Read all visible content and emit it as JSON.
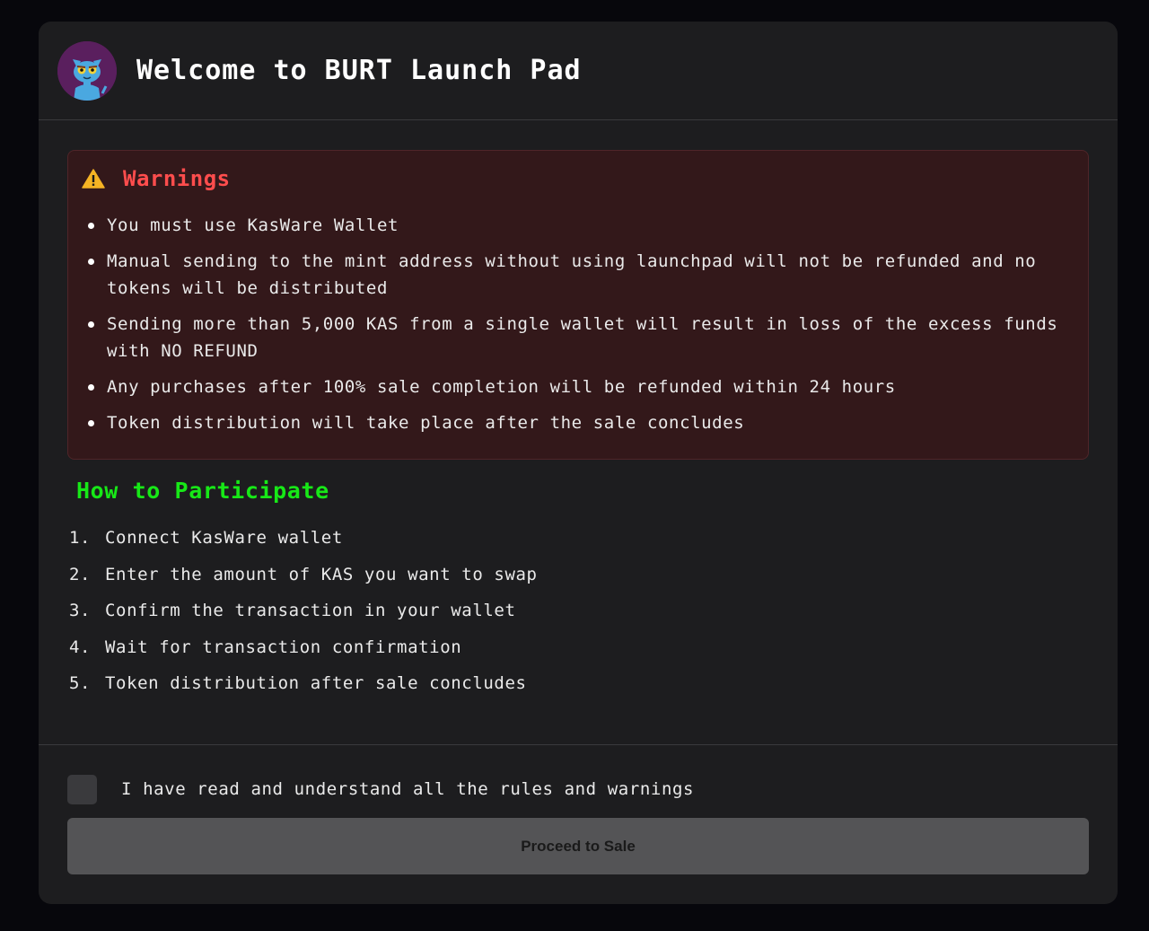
{
  "header": {
    "title": "Welcome to BURT Launch Pad",
    "avatar_icon": "cat-mascot-avatar"
  },
  "warnings": {
    "title": "Warnings",
    "icon": "warning-triangle-icon",
    "items": [
      "You must use KasWare Wallet",
      "Manual sending to the mint address without using launchpad will not be refunded and no tokens will be distributed",
      "Sending more than 5,000 KAS from a single wallet will result in loss of the excess funds with NO REFUND",
      "Any purchases after 100% sale completion will be refunded within 24 hours",
      "Token distribution will take place after the sale concludes"
    ]
  },
  "participate": {
    "title": "How to Participate",
    "steps": [
      {
        "num": "1.",
        "text": "Connect KasWare wallet"
      },
      {
        "num": "2.",
        "text": "Enter the amount of KAS you want to swap"
      },
      {
        "num": "3.",
        "text": "Confirm the transaction in your wallet"
      },
      {
        "num": "4.",
        "text": "Wait for transaction confirmation"
      },
      {
        "num": "5.",
        "text": "Token distribution after sale concludes"
      }
    ]
  },
  "footer": {
    "agree_label": "I have read and understand all the rules and warnings",
    "agree_checked": false,
    "proceed_label": "Proceed to Sale"
  },
  "colors": {
    "background": "#07070c",
    "panel": "#1d1d1f",
    "warning_bg": "#33181a",
    "warning_title": "#ff4d4d",
    "participate_title": "#17e817",
    "button_disabled": "#545456"
  }
}
